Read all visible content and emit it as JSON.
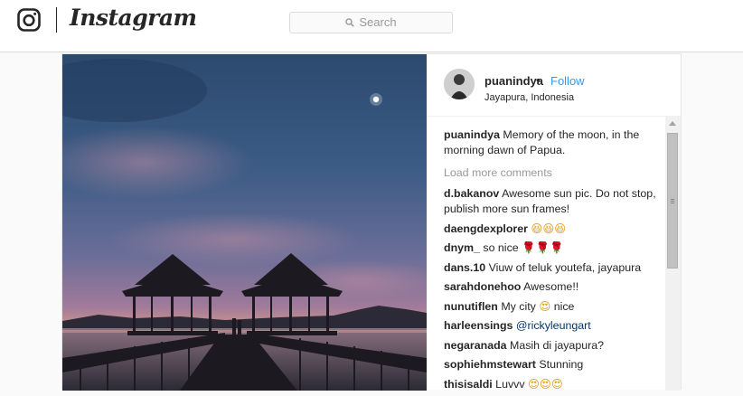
{
  "brand": {
    "wordmark": "Instagram",
    "logo_icon": "instagram-camera-icon"
  },
  "search": {
    "placeholder": "Search",
    "icon": "search-icon"
  },
  "post": {
    "photo_alt": "Two gazebos on a wooden pier at dawn under a moonlit sky",
    "author": {
      "username": "puanindya",
      "separator": "•",
      "follow_label": "Follow",
      "location": "Jayapura, Indonesia"
    },
    "caption": {
      "username": "puanindya",
      "text": "Memory of the moon, in the morning dawn of Papua."
    },
    "load_more_label": "Load more comments",
    "comments": [
      {
        "user": "d.bakanov",
        "text": "Awesome sun pic. Do not stop, publish more sun frames!"
      },
      {
        "user": "daengdexplorer",
        "text": "😆😆😆"
      },
      {
        "user": "dnym_",
        "text": "so nice 🌹🌹🌹"
      },
      {
        "user": "dans.10",
        "text": "Viuw of teluk youtefa, jayapura"
      },
      {
        "user": "sarahdonehoo",
        "text": "Awesome!!"
      },
      {
        "user": "nunutiflen",
        "text_before": "My city",
        "emoji": "😍",
        "text_after": "nice"
      },
      {
        "user": "harleensings",
        "mention": "@rickyleungart"
      },
      {
        "user": "negaranada",
        "text": "Masih di jayapura?"
      },
      {
        "user": "sophiehmstewart",
        "text": "Stunning"
      },
      {
        "user": "thisisaldi",
        "text_before": "Luvvv",
        "emoji": "😍😍😍"
      }
    ]
  },
  "colors": {
    "link": "#3897f0",
    "mention": "#003569",
    "border": "#dbdbdb",
    "background": "#fafafa"
  }
}
